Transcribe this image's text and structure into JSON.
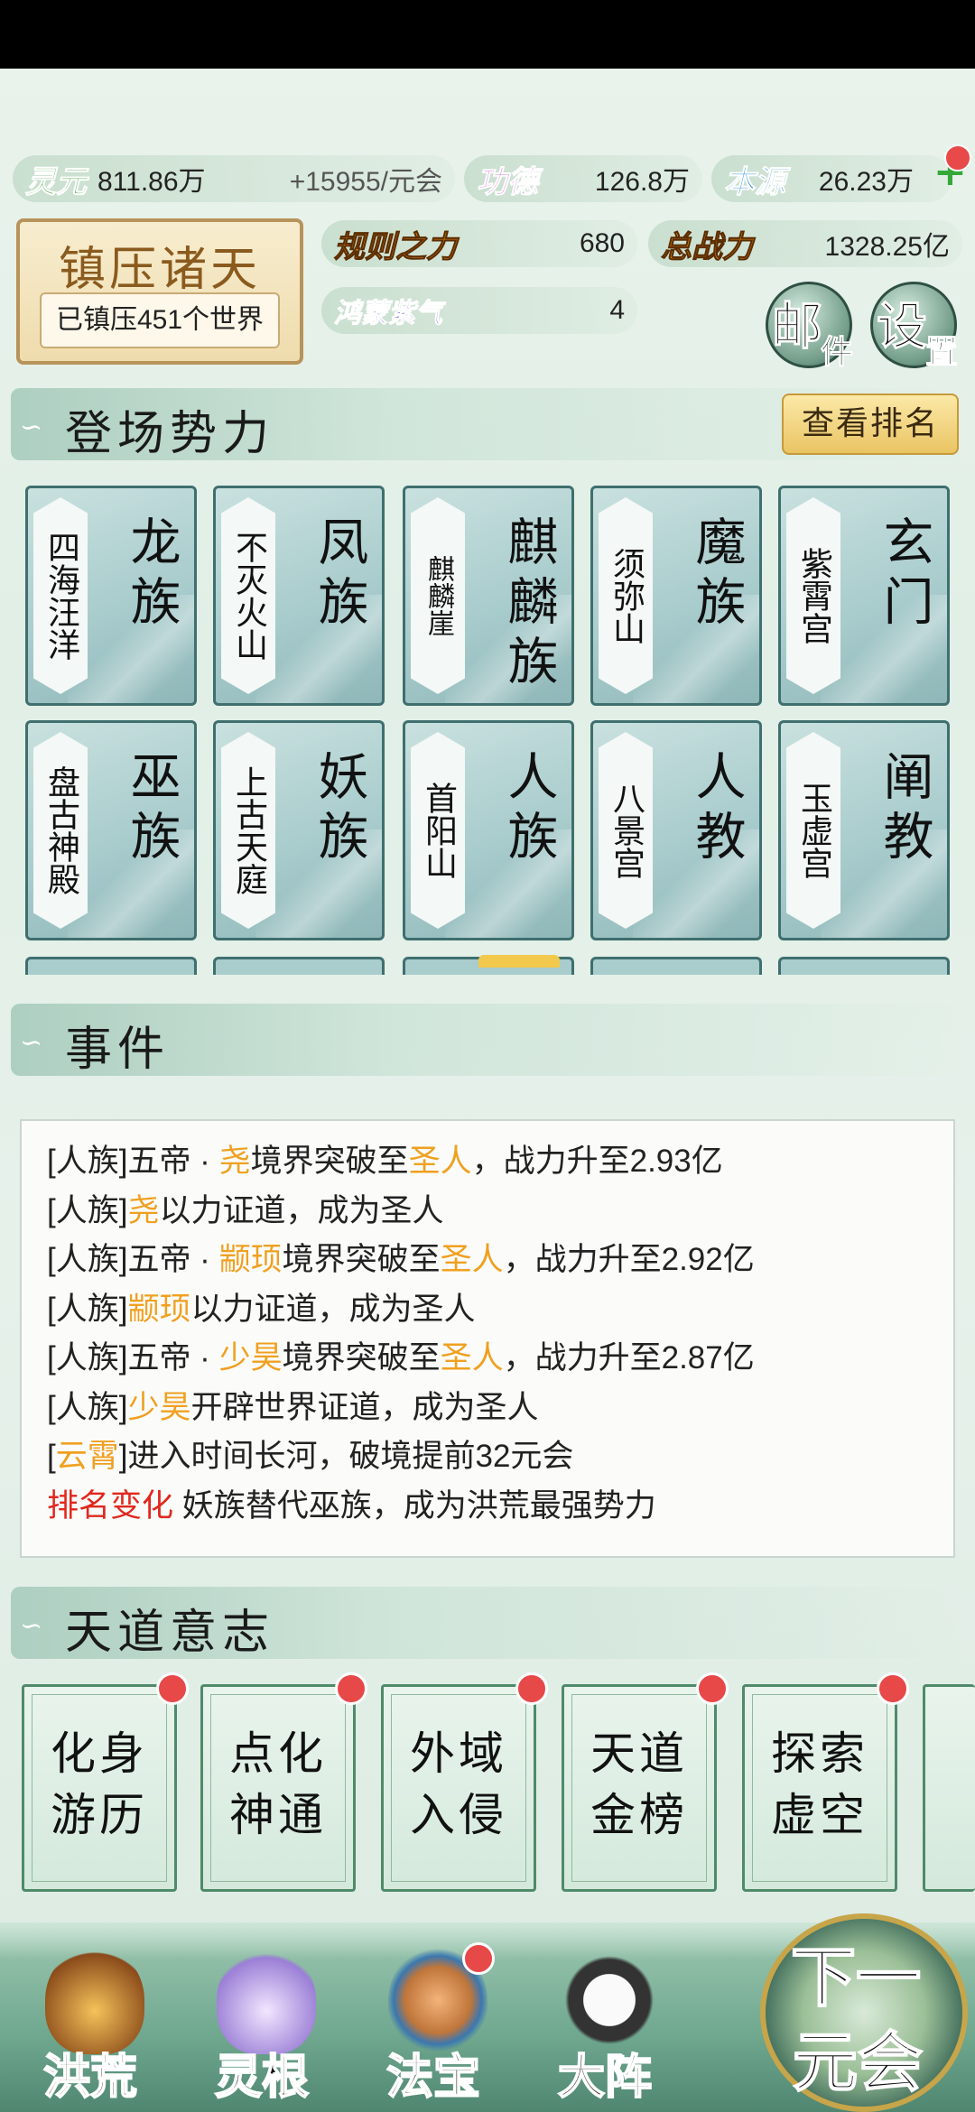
{
  "resources": {
    "lingyuan_label": "灵元",
    "lingyuan_value": "811.86万",
    "lingyuan_rate": "+15955/元会",
    "gongde_label": "功德",
    "gongde_value": "126.8万",
    "benyuan_label": "本源",
    "benyuan_value": "26.23万",
    "guize_label": "规则之力",
    "guize_value": "680",
    "zongzhanli_label": "总战力",
    "zongzhanli_value": "1328.25亿",
    "hongmeng_label": "鸿蒙紫气",
    "hongmeng_value": "4"
  },
  "suppress": {
    "title": "镇压诸天",
    "subtitle": "已镇压451个世界"
  },
  "buttons": {
    "mail_a": "邮",
    "mail_b": "件",
    "settings_a": "设",
    "settings_b": "置",
    "view_rank": "查看排名"
  },
  "sections": {
    "factions_title": "登场势力",
    "events_title": "事件",
    "heaven_title": "天道意志"
  },
  "factions": [
    {
      "place": "四海汪洋",
      "name": "龙族"
    },
    {
      "place": "不灭火山",
      "name": "凤族"
    },
    {
      "place": "麒麟崖",
      "name": "麒麟族"
    },
    {
      "place": "须弥山",
      "name": "魔族"
    },
    {
      "place": "紫霄宫",
      "name": "玄门"
    },
    {
      "place": "盘古神殿",
      "name": "巫族"
    },
    {
      "place": "上古天庭",
      "name": "妖族"
    },
    {
      "place": "首阳山",
      "name": "人族"
    },
    {
      "place": "八景宫",
      "name": "人教"
    },
    {
      "place": "玉虚宫",
      "name": "阐教"
    }
  ],
  "events": [
    {
      "a": "[人族]五帝 · ",
      "h1": "尧",
      "b": "境界突破至",
      "h2": "圣人",
      "c": "，战力升至2.93亿"
    },
    {
      "a": "[人族]",
      "h1": "尧",
      "b": "以力证道，成为圣人",
      "h2": "",
      "c": ""
    },
    {
      "a": "[人族]五帝 · ",
      "h1": "颛顼",
      "b": "境界突破至",
      "h2": "圣人",
      "c": "，战力升至2.92亿"
    },
    {
      "a": "[人族]",
      "h1": "颛顼",
      "b": "以力证道，成为圣人",
      "h2": "",
      "c": ""
    },
    {
      "a": "[人族]五帝 · ",
      "h1": "少昊",
      "b": "境界突破至",
      "h2": "圣人",
      "c": "，战力升至2.87亿"
    },
    {
      "a": "[人族]",
      "h1": "少昊",
      "b": "开辟世界证道，成为圣人",
      "h2": "",
      "c": ""
    },
    {
      "a": "[",
      "h1": "云霄",
      "b": "]进入时间长河，破境提前32元会",
      "h2": "",
      "c": ""
    }
  ],
  "rank_event": {
    "tag": "排名变化",
    "text": " 妖族替代巫族，成为洪荒最强势力"
  },
  "heaven": [
    {
      "l1": "化身",
      "l2": "游历"
    },
    {
      "l1": "点化",
      "l2": "神通"
    },
    {
      "l1": "外域",
      "l2": "入侵"
    },
    {
      "l1": "天道",
      "l2": "金榜"
    },
    {
      "l1": "探索",
      "l2": "虚空"
    }
  ],
  "nav": {
    "honghuang": "洪荒",
    "linggen": "灵根",
    "fabao": "法宝",
    "dazhen": "大阵",
    "next_a": "下一",
    "next_b": "元会"
  }
}
